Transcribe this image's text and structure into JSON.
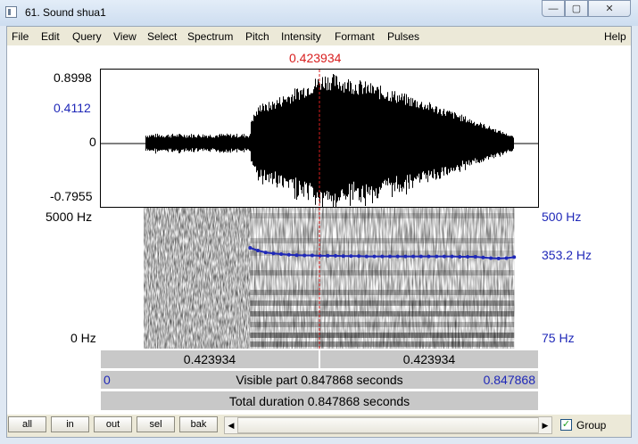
{
  "window": {
    "title": "61. Sound shua1",
    "min_glyph": "—",
    "max_glyph": "▢",
    "close_glyph": "✕"
  },
  "menu": {
    "left": [
      "File",
      "Edit",
      "Query",
      "View",
      "Select",
      "Spectrum",
      "Pitch",
      "Intensity",
      "Formant",
      "Pulses"
    ],
    "help": "Help"
  },
  "cursor": {
    "time_label": "0.423934",
    "time_s": 0.423934,
    "color": "#d81e1e"
  },
  "waveform": {
    "ymax_label": "0.8998",
    "cursor_value_label": "0.4112",
    "zero_label": "0",
    "ymin_label": "-0.7955"
  },
  "spectrogram": {
    "fmax_label": "5000 Hz",
    "fmin_label": "0 Hz"
  },
  "pitch": {
    "top_label": "500 Hz",
    "value_label": "353.2 Hz",
    "bottom_label": "75 Hz",
    "color": "#1f28b8",
    "hz_range": [
      75,
      500
    ],
    "track_hz": [
      379,
      371,
      365,
      362,
      360,
      358,
      357,
      356,
      356,
      355,
      355,
      355,
      354,
      354,
      354,
      353,
      353,
      353,
      353,
      353,
      353,
      353,
      353,
      353,
      353,
      353,
      353,
      352,
      352,
      352,
      350,
      348,
      347,
      348,
      351
    ],
    "track_time_range_s": [
      0.29,
      0.8
    ]
  },
  "sound": {
    "total_duration_s": 0.847868,
    "voicing_onset_s": 0.29,
    "sound_start_s": 0.085,
    "sound_end_s": 0.8
  },
  "bars": {
    "left_selection": "0.423934",
    "right_selection": "0.423934",
    "visible_start": "0",
    "visible_label": "Visible part 0.847868 seconds",
    "visible_end": "0.847868",
    "total_label": "Total duration 0.847868 seconds"
  },
  "buttons": {
    "all": "all",
    "in": "in",
    "out": "out",
    "sel": "sel",
    "bak": "bak"
  },
  "group": {
    "label": "Group",
    "checked": true,
    "check_glyph": "✓"
  },
  "scroll": {
    "left_arrow": "◀",
    "right_arrow": "▶"
  }
}
